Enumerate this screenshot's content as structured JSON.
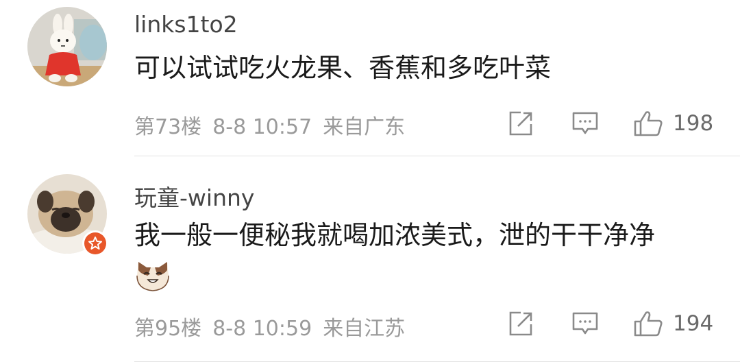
{
  "comments": [
    {
      "username": "links1to2",
      "text": "可以试试吃火龙果、香蕉和多吃叶菜",
      "floor": "第73楼",
      "time": "8-8 10:57",
      "location": "来自广东",
      "likes": "198",
      "avatar": "miffy-toy-avatar",
      "icons": [
        "share-icon",
        "comment-icon",
        "like-icon"
      ]
    },
    {
      "username": "玩童-winny",
      "text": "我一般一便秘我就喝加浓美式，泄的干干净净",
      "floor": "第95楼",
      "time": "8-8 10:59",
      "location": "来自江苏",
      "likes": "194",
      "avatar": "pug-dog-avatar",
      "badge": "star-badge-icon",
      "emoji": "cat-face-emoji",
      "icons": [
        "share-icon",
        "comment-icon",
        "like-icon"
      ]
    }
  ],
  "colors": {
    "text": "#1a1a1a",
    "username": "#444444",
    "meta": "#9a9a9a",
    "icon": "#8a8a8a",
    "badge": "#e8572a",
    "divider": "#e3e3e3"
  }
}
